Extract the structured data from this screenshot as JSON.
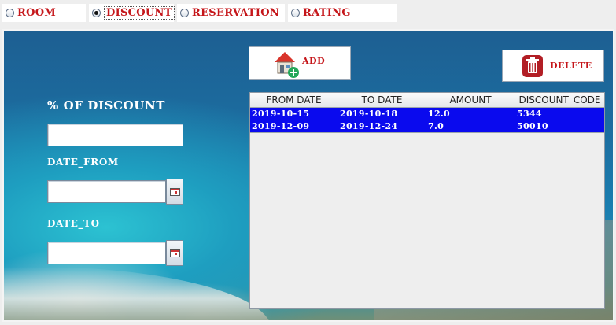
{
  "tabs": [
    {
      "label": "ROOM",
      "selected": false
    },
    {
      "label": "DISCOUNT",
      "selected": true
    },
    {
      "label": "RESERVATION",
      "selected": false
    },
    {
      "label": "RATING",
      "selected": false
    }
  ],
  "form": {
    "discount_label": "% OF DISCOUNT",
    "discount_value": "",
    "date_from_label": "DATE_FROM",
    "date_from_value": "",
    "date_to_label": "DATE_TO",
    "date_to_value": ""
  },
  "buttons": {
    "add_label": "ADD",
    "add_icon": "house-add-icon",
    "delete_label": "DELETE",
    "delete_icon": "trash-icon"
  },
  "table": {
    "columns": [
      "FROM DATE",
      "TO DATE",
      "AMOUNT",
      "DISCOUNT_CODE"
    ],
    "rows": [
      [
        "2019-10-15",
        "2019-10-18",
        "12.0",
        "5344"
      ],
      [
        "2019-12-09",
        "2019-12-24",
        "7.0",
        "50010"
      ]
    ],
    "selected_row_color": "#0a0aee"
  },
  "colors": {
    "accent_text": "#c5161a",
    "table_selection": "#0a0aee"
  }
}
